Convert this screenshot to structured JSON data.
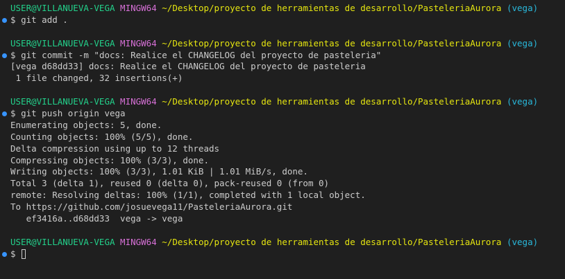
{
  "terminal": {
    "prompt": {
      "user_host": "USER@VILLANUEVA-VEGA",
      "system": "MINGW64",
      "path": "~/Desktop/proyecto de herramientas de desarrollo/PasteleriaAurora",
      "branch": "(vega)",
      "symbol": "$"
    },
    "blocks": [
      {
        "command": "git add .",
        "output": []
      },
      {
        "command": "git commit -m \"docs: Realice el CHANGELOG del proyecto de pasteleria\"",
        "output": [
          "[vega d68dd33] docs: Realice el CHANGELOG del proyecto de pasteleria",
          " 1 file changed, 32 insertions(+)"
        ]
      },
      {
        "command": "git push origin vega",
        "output": [
          "Enumerating objects: 5, done.",
          "Counting objects: 100% (5/5), done.",
          "Delta compression using up to 12 threads",
          "Compressing objects: 100% (3/3), done.",
          "Writing objects: 100% (3/3), 1.01 KiB | 1.01 MiB/s, done.",
          "Total 3 (delta 1), reused 0 (delta 0), pack-reused 0 (from 0)",
          "remote: Resolving deltas: 100% (1/1), completed with 1 local object.",
          "To https://github.com/josuevega11/PasteleriaAurora.git",
          "   ef3416a..d68dd33  vega -> vega"
        ]
      }
    ],
    "current_input": ""
  },
  "colors": {
    "background": "#1f1f1f",
    "user_host": "#23d18b",
    "system": "#d670d6",
    "path": "#e5e510",
    "branch": "#29b8db",
    "text": "#cccccc",
    "decoration": "#3794ff"
  }
}
